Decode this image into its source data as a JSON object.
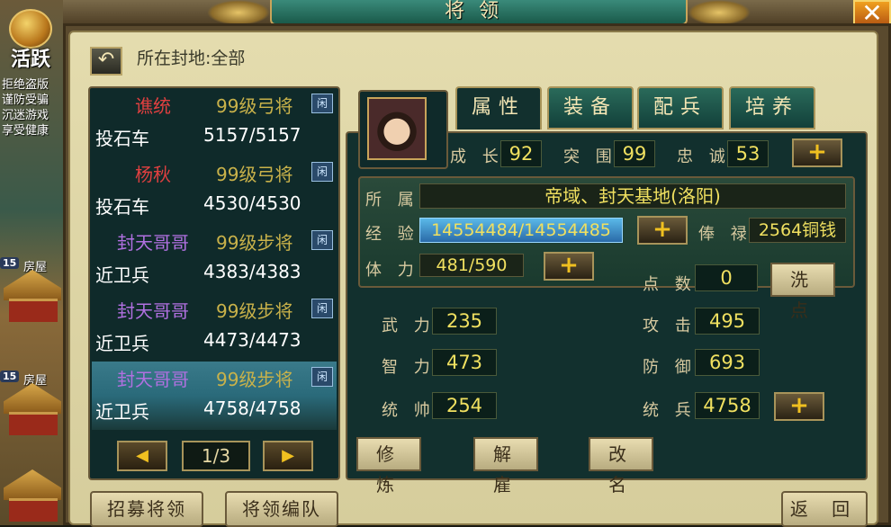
{
  "window": {
    "title": "将领",
    "close_icon": "✕"
  },
  "left_strip": {
    "activity_label": "活跃",
    "notice_lines": [
      "拒绝盗版",
      "谨防受骗",
      "沉迷游戏",
      "享受健康"
    ],
    "houses": [
      {
        "level": "15",
        "name": "房屋"
      },
      {
        "level": "15",
        "name": "房屋"
      },
      {
        "level": "15",
        "name": ""
      }
    ]
  },
  "header": {
    "back_icon": "↶",
    "location_label": "所在封地:全部"
  },
  "general_list": [
    {
      "name": "谯统",
      "name_color": "#e04040",
      "level": "99级弓将",
      "tag": "闲",
      "unit": "投石车",
      "count": "5157/5157"
    },
    {
      "name": "杨秋",
      "name_color": "#e04040",
      "level": "99级弓将",
      "tag": "闲",
      "unit": "投石车",
      "count": "4530/4530"
    },
    {
      "name": "封天哥哥",
      "name_color": "#b070e0",
      "level": "99级步将",
      "tag": "闲",
      "unit": "近卫兵",
      "count": "4383/4383"
    },
    {
      "name": "封天哥哥",
      "name_color": "#b070e0",
      "level": "99级步将",
      "tag": "闲",
      "unit": "近卫兵",
      "count": "4473/4473"
    },
    {
      "name": "封天哥哥",
      "name_color": "#b070e0",
      "level": "99级步将",
      "tag": "闲",
      "unit": "近卫兵",
      "count": "4758/4758"
    }
  ],
  "pager": {
    "prev_icon": "◀",
    "next_icon": "▶",
    "page": "1/3"
  },
  "tabs": [
    "属性",
    "装备",
    "配兵",
    "培养"
  ],
  "attributes": {
    "growth_label": "成 长",
    "growth": "92",
    "breakout_label": "突 围",
    "breakout": "99",
    "loyalty_label": "忠 诚",
    "loyalty": "53",
    "plus": "+",
    "belong_label": "所 属",
    "belong": "帝域、封天基地(洛阳)",
    "exp_label": "经 验",
    "exp": "14554484/14554485",
    "salary_label": "俸 禄",
    "salary": "2564铜钱",
    "stamina_label": "体 力",
    "stamina": "481/590",
    "points_label": "点 数",
    "points": "0",
    "reset_label": "洗 点",
    "force_label": "武 力",
    "force": "235",
    "attack_label": "攻 击",
    "attack": "495",
    "intellect_label": "智 力",
    "intellect": "473",
    "defense_label": "防 御",
    "defense": "693",
    "command_label": "统 帅",
    "command": "254",
    "troops_label": "统 兵",
    "troops": "4758"
  },
  "actions": {
    "train": "修 炼",
    "dismiss": "解 雇",
    "rename": "改 名"
  },
  "footer": {
    "recruit": "招募将领",
    "formation": "将领编队",
    "back": "返 回"
  }
}
